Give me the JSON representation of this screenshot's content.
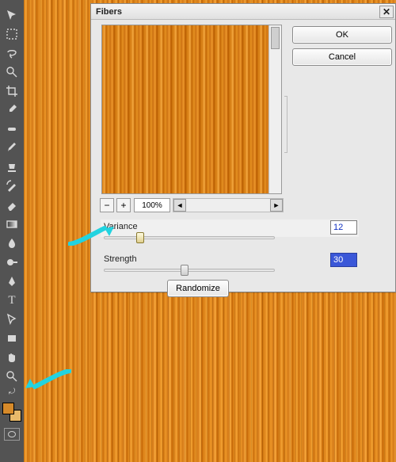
{
  "toolbar": {
    "tools": [
      "move-tool",
      "marquee-tool",
      "lasso-tool",
      "quick-select-tool",
      "crop-tool",
      "eyedropper-tool",
      "spot-heal-tool",
      "brush-tool",
      "clone-stamp-tool",
      "history-brush-tool",
      "eraser-tool",
      "gradient-tool",
      "blur-tool",
      "dodge-tool",
      "pen-tool",
      "type-tool",
      "path-select-tool",
      "rectangle-tool",
      "hand-tool",
      "zoom-tool"
    ],
    "foreground_color": "#d68a2a",
    "background_color": "#e8b96a"
  },
  "dialog": {
    "title": "Fibers",
    "buttons": {
      "ok": "OK",
      "cancel": "Cancel",
      "randomize": "Randomize"
    },
    "close_label": "✕",
    "zoom": {
      "minus": "−",
      "plus": "+",
      "value": "100%",
      "left": "◄",
      "right": "►"
    },
    "params": {
      "variance": {
        "label": "Variance",
        "value": "12"
      },
      "strength": {
        "label": "Strength",
        "value": "30"
      }
    }
  }
}
